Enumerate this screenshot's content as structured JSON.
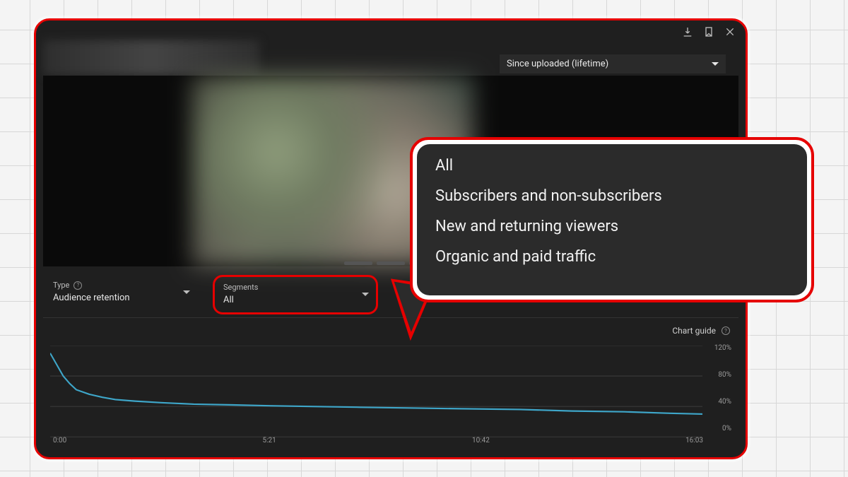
{
  "header": {
    "daterange_label": "Since uploaded (lifetime)"
  },
  "controls": {
    "type": {
      "label": "Type",
      "value": "Audience retention"
    },
    "segments": {
      "label": "Segments",
      "value": "All"
    }
  },
  "chart_guide_label": "Chart guide",
  "segments_menu": {
    "opt0": "All",
    "opt1": "Subscribers and non-subscribers",
    "opt2": "New and returning viewers",
    "opt3": "Organic and paid traffic"
  },
  "chart_data": {
    "type": "line",
    "title": "Audience retention",
    "xlabel": "",
    "ylabel": "",
    "ylim": [
      0,
      120
    ],
    "yticks": [
      "0%",
      "40%",
      "80%",
      "120%"
    ],
    "xticks": [
      "0:00",
      "5:21",
      "10:42",
      "16:03"
    ],
    "x": [
      0.0,
      0.01,
      0.02,
      0.03,
      0.04,
      0.06,
      0.08,
      0.1,
      0.13,
      0.17,
      0.22,
      0.28,
      0.33,
      0.4,
      0.47,
      0.55,
      0.63,
      0.72,
      0.8,
      0.88,
      0.95,
      1.0
    ],
    "values": [
      110,
      95,
      80,
      70,
      62,
      56,
      52,
      49,
      47,
      45,
      43,
      42,
      41,
      40,
      39,
      38,
      37,
      36,
      34,
      33,
      31,
      30
    ]
  }
}
